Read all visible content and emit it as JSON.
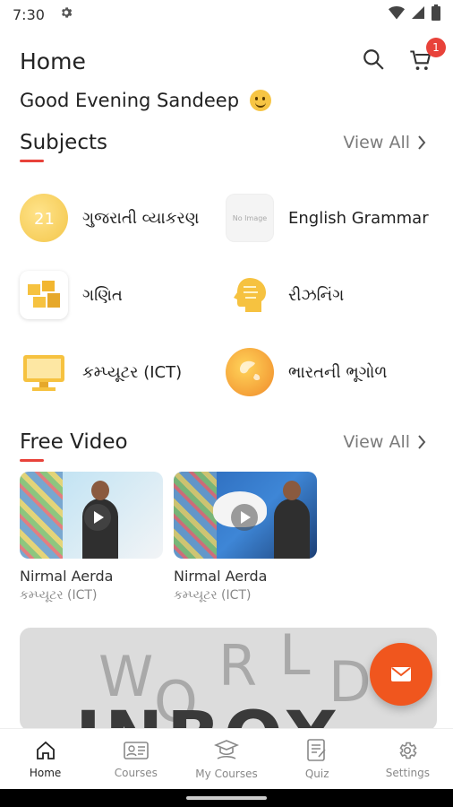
{
  "status": {
    "time": "7:30"
  },
  "appbar": {
    "title": "Home",
    "cart_count": "1"
  },
  "greeting": "Good Evening Sandeep",
  "subjects": {
    "heading": "Subjects",
    "view_all": "View All",
    "items": [
      {
        "label": "ગુજરાતી વ્યાકરણ",
        "icon": "gujarati-grammar-icon",
        "color": "#f3c64a"
      },
      {
        "label": "English Grammar",
        "icon": "no-image-placeholder",
        "color": "#f4f4f4"
      },
      {
        "label": "ગણિત",
        "icon": "math-blocks-icon",
        "color": "#f6c240"
      },
      {
        "label": "રીઝનિંગ",
        "icon": "brain-head-icon",
        "color": "#f6c240"
      },
      {
        "label": "કમ્પ્યૂટર (ICT)",
        "icon": "computer-icon",
        "color": "#f6c240"
      },
      {
        "label": "ભારતની ભૂગોળ",
        "icon": "globe-icon",
        "color": "#f08a2a"
      }
    ]
  },
  "free_video": {
    "heading": "Free Video",
    "view_all": "View All",
    "items": [
      {
        "name": "Nirmal Aerda",
        "subject": "કમ્પ્યૂટર (ICT)"
      },
      {
        "name": "Nirmal Aerda",
        "subject": "કમ્પ્યૂટર (ICT)"
      }
    ]
  },
  "banner": {
    "letters": [
      "W",
      "O",
      "R",
      "L",
      "D"
    ],
    "big_word": "INBOX"
  },
  "no_image_text": "No Image",
  "nav": {
    "items": [
      {
        "label": "Home",
        "icon": "home-icon"
      },
      {
        "label": "Courses",
        "icon": "courses-icon"
      },
      {
        "label": "My Courses",
        "icon": "my-courses-icon"
      },
      {
        "label": "Quiz",
        "icon": "quiz-icon"
      },
      {
        "label": "Settings",
        "icon": "settings-icon"
      }
    ],
    "active": "Home"
  },
  "colors": {
    "accent": "#e8423a",
    "fab": "#f0561e"
  }
}
